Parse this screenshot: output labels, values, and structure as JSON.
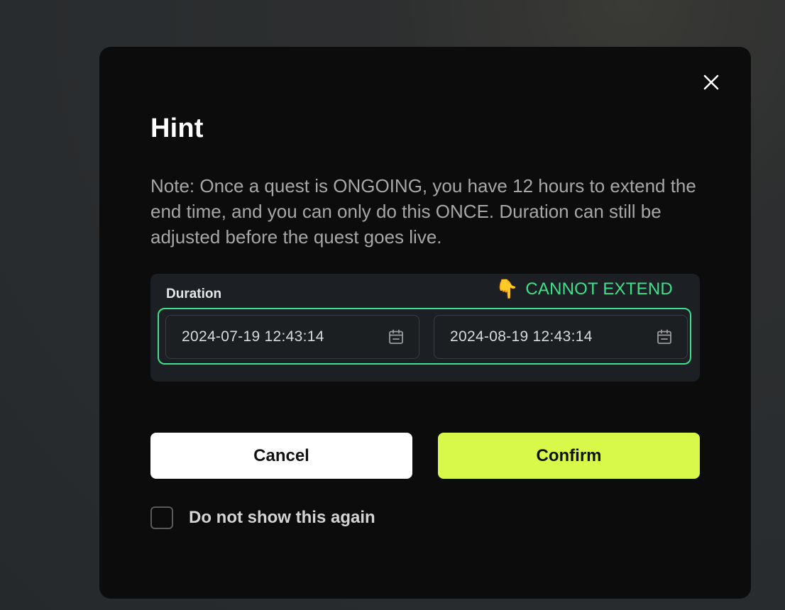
{
  "modal": {
    "title": "Hint",
    "note": "Note: Once a quest is ONGOING, you have 12 hours to extend the end time, and you can only do this ONCE. Duration can still be adjusted before the quest goes live.",
    "close_icon": "close-icon"
  },
  "duration": {
    "label": "Duration",
    "warning_emoji": "👇",
    "warning_text": "CANNOT EXTEND",
    "start_value": "2024-07-19 12:43:14",
    "end_value": "2024-08-19 12:43:14",
    "calendar_icon": "calendar-icon"
  },
  "actions": {
    "cancel_label": "Cancel",
    "confirm_label": "Confirm"
  },
  "dont_show": {
    "label": "Do not show this again",
    "checked": false
  },
  "colors": {
    "accent_green": "#3ee08a",
    "confirm_bg": "#d8f84a",
    "modal_bg": "#0c0c0c"
  }
}
